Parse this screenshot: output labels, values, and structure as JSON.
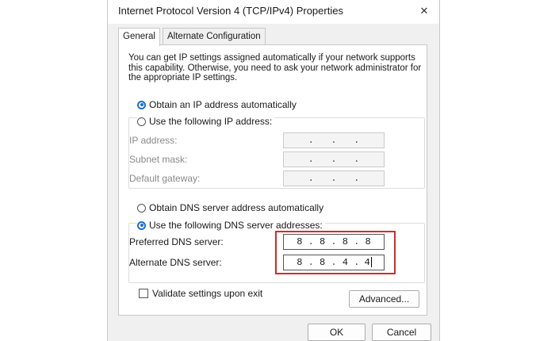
{
  "window": {
    "title": "Internet Protocol Version 4 (TCP/IPv4) Properties",
    "close_glyph": "✕"
  },
  "tabs": [
    {
      "label": "General",
      "active": true
    },
    {
      "label": "Alternate Configuration",
      "active": false
    }
  ],
  "description": "You can get IP settings assigned automatically if your network supports this capability. Otherwise, you need to ask your network administrator for the appropriate IP settings.",
  "ip_settings": {
    "auto_label": "Obtain an IP address automatically",
    "manual_label": "Use the following IP address:",
    "selected": "auto",
    "fields": [
      {
        "label": "IP address:",
        "octets": [
          "",
          "",
          "",
          ""
        ]
      },
      {
        "label": "Subnet mask:",
        "octets": [
          "",
          "",
          "",
          ""
        ]
      },
      {
        "label": "Default gateway:",
        "octets": [
          "",
          "",
          "",
          ""
        ]
      }
    ]
  },
  "dns_settings": {
    "auto_label": "Obtain DNS server address automatically",
    "manual_label": "Use the following DNS server addresses:",
    "selected": "manual",
    "preferred": {
      "label": "Preferred DNS server:",
      "octets": [
        "8",
        "8",
        "8",
        "8"
      ]
    },
    "alternate": {
      "label": "Alternate DNS server:",
      "octets": [
        "8",
        "8",
        "4",
        "4"
      ]
    }
  },
  "validate": {
    "label": "Validate settings upon exit",
    "checked": false
  },
  "buttons": {
    "advanced": "Advanced...",
    "ok": "OK",
    "cancel": "Cancel"
  },
  "colors": {
    "highlight": "#d42a2a",
    "accent": "#1f6fc7"
  }
}
